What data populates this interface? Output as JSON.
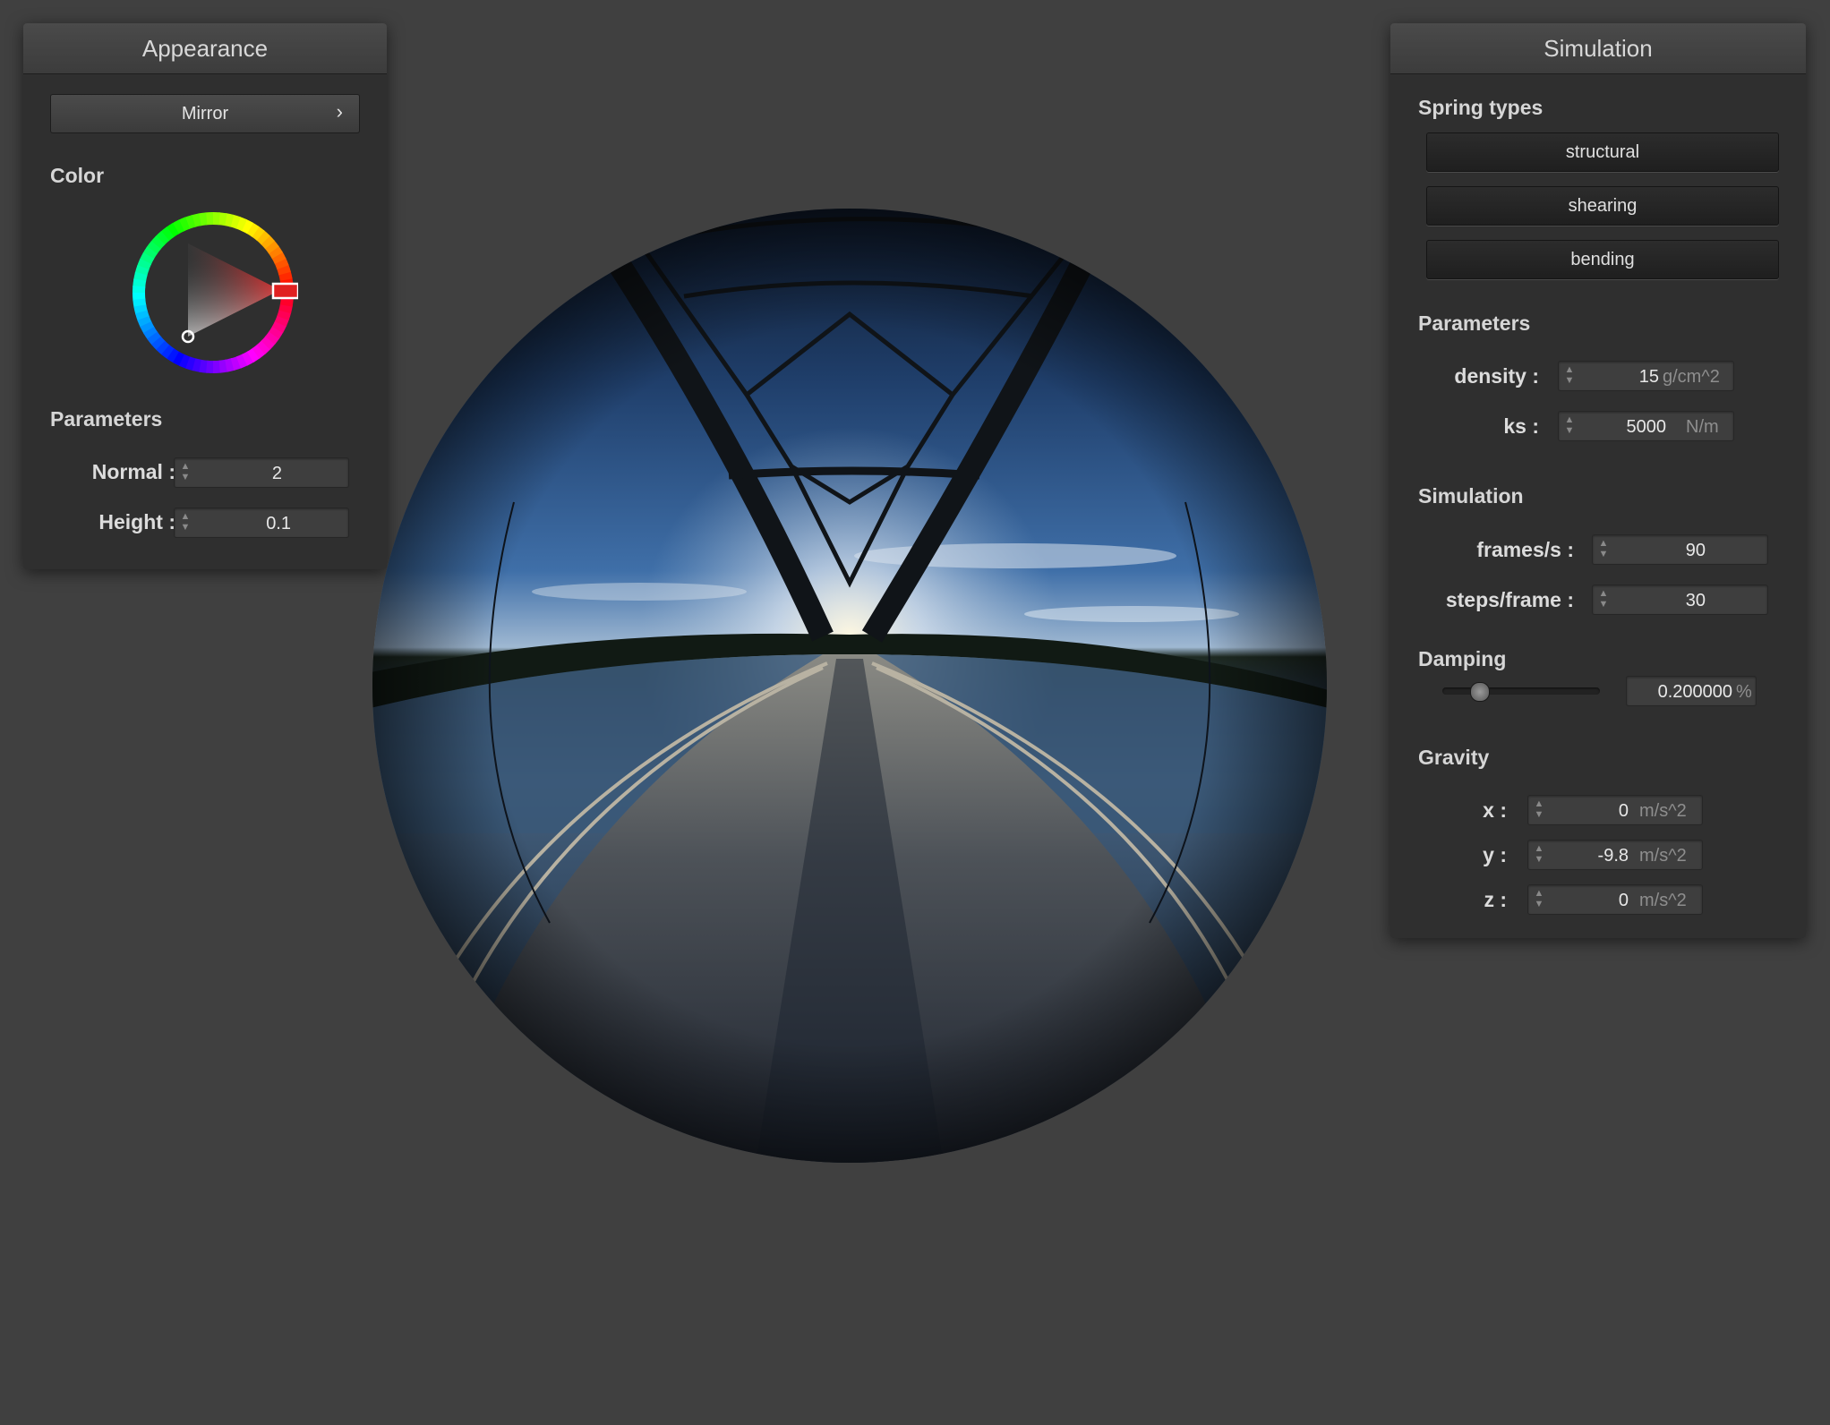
{
  "appearance": {
    "title": "Appearance",
    "material_button": "Mirror",
    "material_chevron": "›",
    "color_label": "Color",
    "parameters_label": "Parameters",
    "normal_label": "Normal :",
    "normal_value": "2",
    "height_label": "Height :",
    "height_value": "0.1",
    "selected_color": "#e02020"
  },
  "simulation": {
    "title": "Simulation",
    "spring_types_label": "Spring types",
    "spring_buttons": [
      "structural",
      "shearing",
      "bending"
    ],
    "parameters_label": "Parameters",
    "density_label": "density :",
    "density_value": "15",
    "density_unit": "g/cm^2",
    "ks_label": "ks :",
    "ks_value": "5000",
    "ks_unit": "N/m",
    "sim_label": "Simulation",
    "fps_label": "frames/s :",
    "fps_value": "90",
    "steps_label": "steps/frame :",
    "steps_value": "30",
    "damping_label": "Damping",
    "damping_value": "0.200000",
    "damping_unit": "%",
    "damping_slider_fraction": 0.2,
    "gravity_label": "Gravity",
    "gx_label": "x :",
    "gx_value": "0",
    "gy_label": "y :",
    "gy_value": "-9.8",
    "gz_label": "z :",
    "gz_value": "0",
    "gravity_unit": "m/s^2"
  },
  "viewport": {
    "object": "mirror-sphere",
    "environment": "bridge-over-lake"
  }
}
